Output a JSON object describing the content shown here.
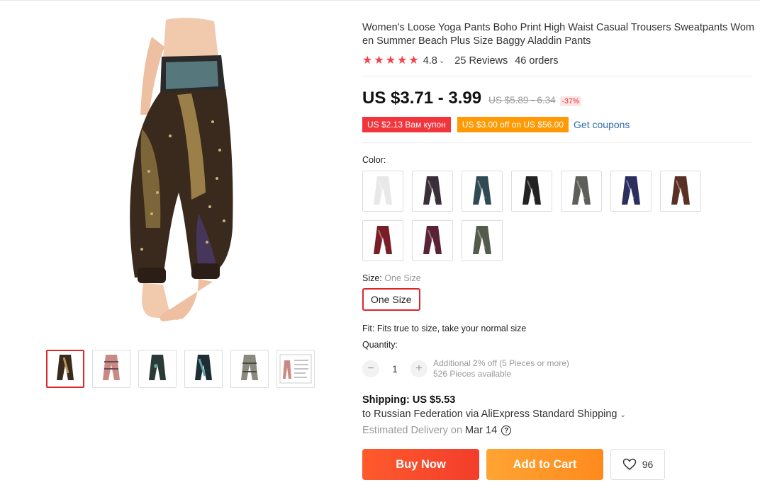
{
  "product": {
    "title": "Women's Loose Yoga Pants Boho Print High Waist Casual Trousers Sweatpants Women Summer Beach Plus Size Baggy Aladdin Pants",
    "rating": "4.8",
    "reviews": "25 Reviews",
    "orders": "46 orders",
    "price": "US $3.71 - 3.99",
    "old_price": "US $5.89 - 6.34",
    "discount": "-37%",
    "coupons": [
      "US $2.13 Вам купон",
      "US $3.00 off on US $56.00"
    ],
    "get_coupons": "Get coupons",
    "rating_stars": 5
  },
  "color": {
    "label": "Color:",
    "swatches": [
      {
        "name": "white",
        "color": "#e8e8e8"
      },
      {
        "name": "purple-black",
        "color": "#3a2f38"
      },
      {
        "name": "teal",
        "color": "#2f4a52"
      },
      {
        "name": "black",
        "color": "#222222"
      },
      {
        "name": "grey",
        "color": "#5e5e5a"
      },
      {
        "name": "navy-purple",
        "color": "#2c2e5e"
      },
      {
        "name": "brown",
        "color": "#5a3024"
      },
      {
        "name": "wine",
        "color": "#7a1e25"
      },
      {
        "name": "plum",
        "color": "#5a2235"
      },
      {
        "name": "olive-grey",
        "color": "#545a4c"
      }
    ]
  },
  "size": {
    "label": "Size:",
    "selected": "One Size",
    "option": "One Size"
  },
  "fit": "Fit: Fits true to size, take your normal size",
  "quantity": {
    "label": "Quantity:",
    "value": "1",
    "minus": "−",
    "plus": "+",
    "additional": "Additional 2% off (5 Pieces or more)",
    "available": "526 Pieces available"
  },
  "shipping": {
    "title": "Shipping: US $5.53",
    "destination": "to Russian Federation via AliExpress Standard Shipping",
    "delivery_label": "Estimated Delivery on",
    "delivery_date": "Mar 14",
    "help": "?"
  },
  "actions": {
    "buy_now": "Buy Now",
    "add_to_cart": "Add to Cart",
    "wishlist_count": "96"
  },
  "colors": {
    "accent_red": "#f2353c",
    "coupon_orange": "#ff9a05",
    "link_blue": "#2e6ea8"
  },
  "gallery": {
    "thumbnails": [
      "peacock-black",
      "pink-paisley",
      "teal-dark",
      "dark-print",
      "grey-paisley",
      "size-chart"
    ]
  }
}
